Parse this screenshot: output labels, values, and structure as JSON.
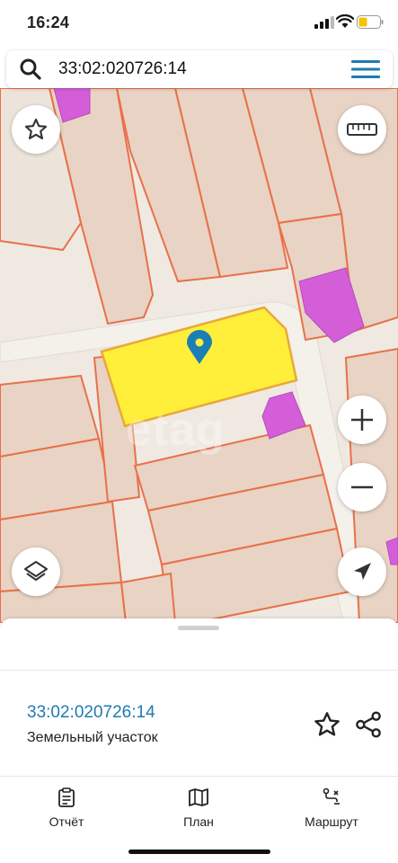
{
  "status_bar": {
    "time": "16:24"
  },
  "search": {
    "query": "33:02:020726:14"
  },
  "map": {
    "watermark": "etag",
    "icons": {
      "favorite": "star-icon",
      "ruler": "ruler-icon",
      "zoom_in": "plus-icon",
      "zoom_out": "minus-icon",
      "layers": "layers-icon",
      "locate": "navigation-arrow-icon",
      "pin": "location-pin-icon"
    },
    "colors": {
      "selected_parcel": "#ffee3a",
      "parcel_border": "#e8704a",
      "building": "#d45ed8",
      "pin": "#1a7fb5",
      "land": "#efe9e1"
    }
  },
  "sheet": {
    "cadastral_number": "33:02:020726:14",
    "object_type": "Земельный участок"
  },
  "nav": {
    "items": [
      {
        "label": "Отчёт",
        "icon": "report-icon"
      },
      {
        "label": "План",
        "icon": "map-icon"
      },
      {
        "label": "Маршрут",
        "icon": "route-icon"
      }
    ]
  }
}
